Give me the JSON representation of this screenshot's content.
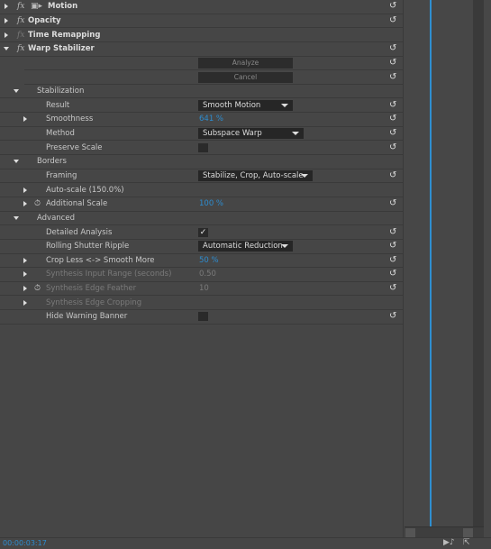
{
  "effects": [
    {
      "name": "Motion",
      "fx_enabled": true
    },
    {
      "name": "Opacity",
      "fx_enabled": true
    },
    {
      "name": "Time Remapping",
      "fx_enabled": false
    },
    {
      "name": "Warp Stabilizer",
      "fx_enabled": true
    }
  ],
  "warp": {
    "analyze_label": "Analyze",
    "cancel_label": "Cancel",
    "stabilization": "Stabilization",
    "result_label": "Result",
    "result_value": "Smooth Motion",
    "smoothness_label": "Smoothness",
    "smoothness_value": "641 %",
    "method_label": "Method",
    "method_value": "Subspace Warp",
    "preserve_label": "Preserve Scale",
    "preserve_checked": false,
    "borders": "Borders",
    "framing_label": "Framing",
    "framing_value": "Stabilize, Crop, Auto-scale",
    "autoscale_label": "Auto-scale (150.0%)",
    "addscale_label": "Additional Scale",
    "addscale_value": "100 %",
    "advanced": "Advanced",
    "detailed_label": "Detailed Analysis",
    "detailed_checked": true,
    "check": "✓",
    "rolling_label": "Rolling Shutter Ripple",
    "rolling_value": "Automatic Reduction",
    "cropless_label": "Crop Less <-> Smooth More",
    "cropless_value": "50 %",
    "synth_range_label": "Synthesis Input Range (seconds)",
    "synth_range_value": "0.50",
    "synth_feather_label": "Synthesis Edge Feather",
    "synth_feather_value": "10",
    "synth_crop_label": "Synthesis Edge Cropping",
    "hide_label": "Hide Warning Banner",
    "hide_checked": false
  },
  "status": {
    "timecode": "00:00:03:17"
  },
  "colors": {
    "accent": "#2d8ccf",
    "panel": "#464646"
  }
}
